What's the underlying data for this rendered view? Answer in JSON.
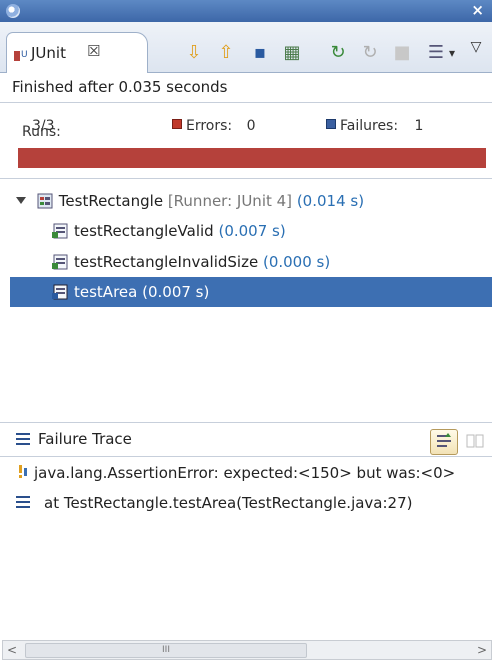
{
  "window": {
    "close_glyph": "×"
  },
  "tab": {
    "label": "JUnit",
    "close_glyph": "☒"
  },
  "toolbar": [
    {
      "name": "next-failure-icon",
      "glyph": "⇩",
      "color": "#e0a020"
    },
    {
      "name": "previous-failure-icon",
      "glyph": "⇧",
      "color": "#e0a020"
    },
    {
      "name": "show-failures-only-icon",
      "glyph": "▪",
      "color": "#2a5aa0"
    },
    {
      "name": "scroll-lock-icon",
      "glyph": "▦",
      "color": "#4a7a4a"
    },
    {
      "name": "rerun-test-icon",
      "glyph": "↻",
      "color": "#3a8a3a"
    },
    {
      "name": "rerun-failed-first-icon",
      "glyph": "↻",
      "color": "#b0b0b0"
    },
    {
      "name": "stop-icon",
      "glyph": "■",
      "color": "#c8c8c8"
    },
    {
      "name": "test-run-history-icon",
      "glyph": "☰",
      "color": "#557"
    },
    {
      "name": "history-dropdown-icon",
      "glyph": "▾",
      "color": "#333"
    },
    {
      "name": "view-menu-icon",
      "glyph": "▽",
      "color": "#333"
    }
  ],
  "status": {
    "text": "Finished after 0.035 seconds"
  },
  "counters": {
    "runs_label": "Runs:",
    "runs_value": "3/3",
    "errors_label": "Errors:",
    "errors_value": "0",
    "failures_label": "Failures:",
    "failures_value": "1"
  },
  "progress": {
    "fraction": 1.0,
    "color": "#b5413b"
  },
  "tree": {
    "root": {
      "name": "TestRectangle",
      "runner": "[Runner: JUnit 4]",
      "time": "(0.014 s)"
    },
    "items": [
      {
        "name": "testRectangleValid",
        "time": "(0.007 s)"
      },
      {
        "name": "testRectangleInvalidSize",
        "time": "(0.000 s)"
      },
      {
        "name": "testArea",
        "time": "(0.007 s)"
      }
    ]
  },
  "failure_trace": {
    "title": "Failure Trace",
    "lines": [
      "java.lang.AssertionError: expected:<150> but was:<0>",
      "at TestRectangle.testArea(TestRectangle.java:27)"
    ]
  },
  "scrollbar": {
    "left": "<",
    "right": ">",
    "grip": "III"
  }
}
